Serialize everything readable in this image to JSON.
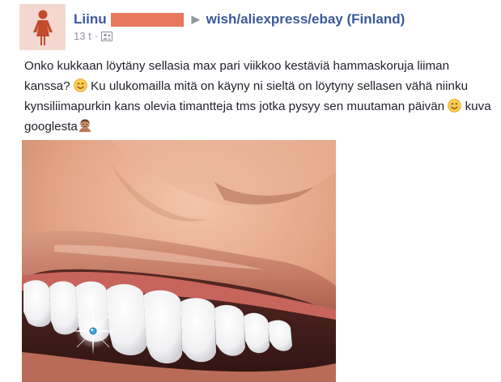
{
  "post": {
    "author_name": "Liinu",
    "arrow_glyph": "▶",
    "group_name": "wish/aliexpress/ebay (Finland)",
    "timestamp": "13 t",
    "separator": "·",
    "audience_icon": "group-audience-icon",
    "body": {
      "segment1": "Onko kukkaan löytäny sellasia max pari viikkoo kestäviä hammaskoruja liiman kanssa? ",
      "segment2": " Ku ulukomailla mitä on käyny ni sieltä on löytyny sellasen vähä niinku kynsiliimapurkin kans olevia timantteja tms jotka pysyy sen muutaman päivän ",
      "segment3": " kuva googlesta"
    },
    "emojis": [
      "smiling-face-emoji",
      "smiling-face-emoji",
      "person-gesturing-emoji"
    ]
  },
  "colors": {
    "link": "#3b5998",
    "redaction": "#e8785d",
    "avatar_bg": "#f4d8cf",
    "avatar_icon": "#c34a2c",
    "meta_text": "#90949c"
  }
}
